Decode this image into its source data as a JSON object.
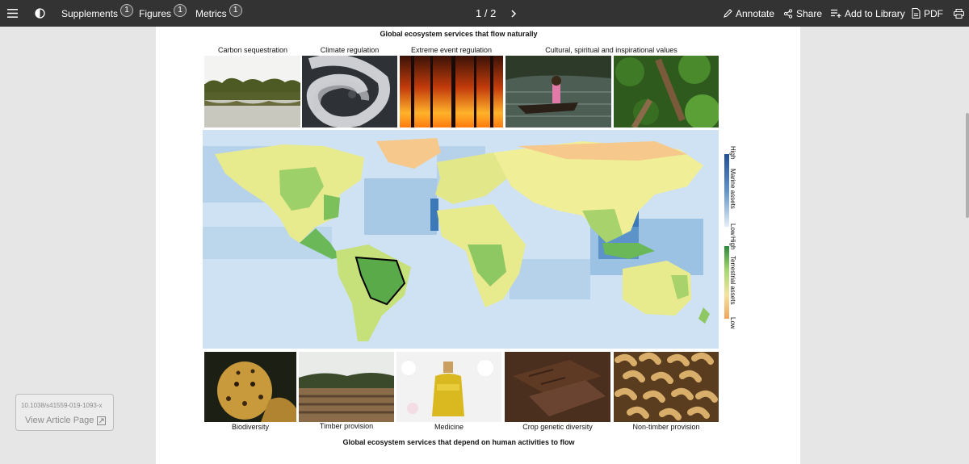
{
  "toolbar": {
    "supplements_label": "Supplements",
    "supplements_count": "1",
    "figures_label": "Figures",
    "figures_count": "1",
    "metrics_label": "Metrics",
    "metrics_count": "1",
    "page_indicator": "1 / 2",
    "annotate_label": "Annotate",
    "share_label": "Share",
    "add_to_library_label": "Add to Library",
    "pdf_label": "PDF"
  },
  "article": {
    "doi": "10.1038/s41559-019-1093-x",
    "view_article_label": "View Article Page"
  },
  "figure": {
    "top_title": "Global ecosystem services that flow naturally",
    "bottom_title": "Global ecosystem services that depend on human activities to flow",
    "top_labels": [
      "Carbon sequestration",
      "Climate regulation",
      "Extreme event regulation",
      "Cultural, spiritual and inspirational values"
    ],
    "bottom_labels": [
      "Biodiversity",
      "Timber provision",
      "Medicine",
      "Crop genetic diversity",
      "Non-timber provision"
    ],
    "legend": {
      "marine_high": "High",
      "marine_title": "Marine assets",
      "marine_low": "Low",
      "terrestrial_high": "High",
      "terrestrial_title": "Terrestrial assets",
      "terrestrial_low": "Low"
    }
  }
}
